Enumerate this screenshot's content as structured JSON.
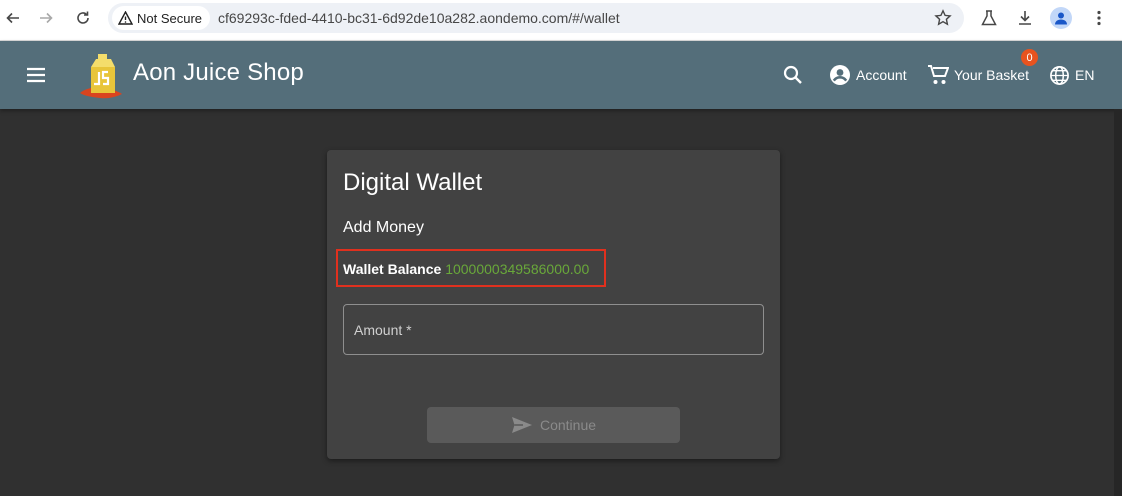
{
  "browser": {
    "security_label": "Not Secure",
    "url": "cf69293c-fded-4410-bc31-6d92de10a282.aondemo.com/#/wallet"
  },
  "app": {
    "title": "Aon Juice Shop",
    "account_label": "Account",
    "basket_label": "Your Basket",
    "basket_count": "0",
    "language_label": "EN",
    "toolbar_color": "#546e7a"
  },
  "wallet": {
    "title": "Digital Wallet",
    "subtitle": "Add Money",
    "balance_label": "Wallet Balance",
    "balance_value": "1000000349586000.00",
    "amount_label": "Amount *",
    "continue_label": "Continue",
    "balance_color": "#69a83a",
    "highlight_color": "#e0301e"
  }
}
